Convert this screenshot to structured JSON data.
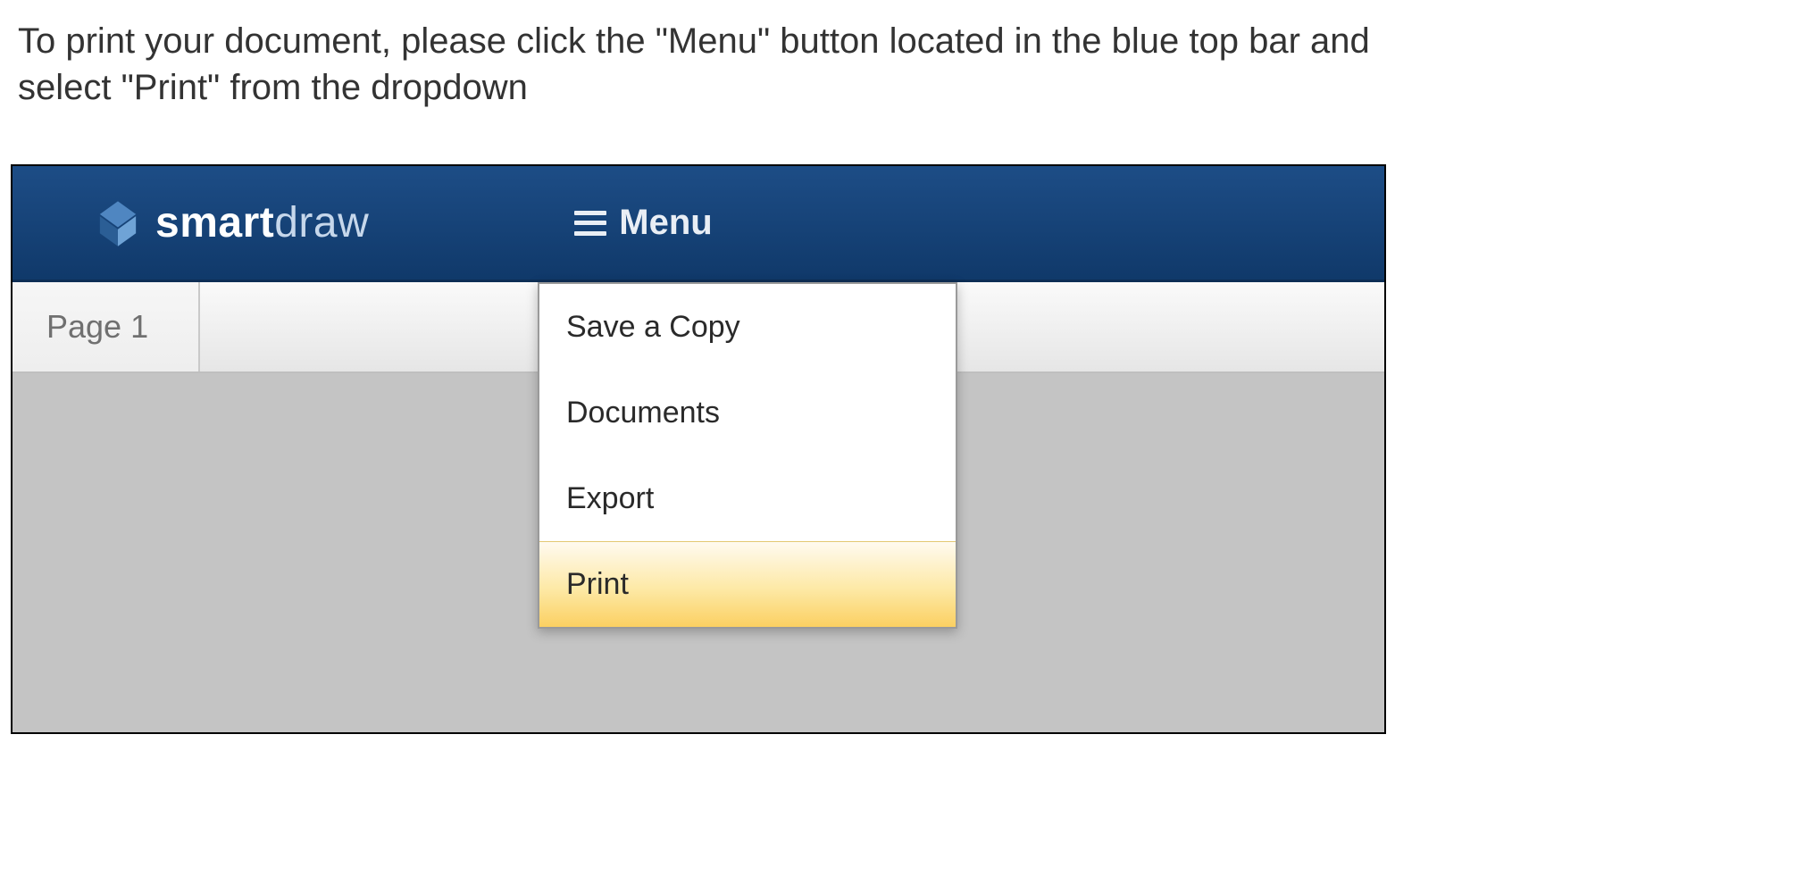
{
  "instruction_text": "To print your document, please click the \"Menu\" button located in the blue top bar and select \"Print\" from the dropdown",
  "top_bar": {
    "brand_bold": "smart",
    "brand_light": "draw",
    "menu_button_label": "Menu"
  },
  "pages": {
    "active_tab_label": "Page 1"
  },
  "menu_dropdown": {
    "items": [
      {
        "label": "Save a Copy",
        "highlight": false
      },
      {
        "label": "Documents",
        "highlight": false
      },
      {
        "label": "Export",
        "highlight": false
      },
      {
        "label": "Print",
        "highlight": true
      }
    ]
  }
}
